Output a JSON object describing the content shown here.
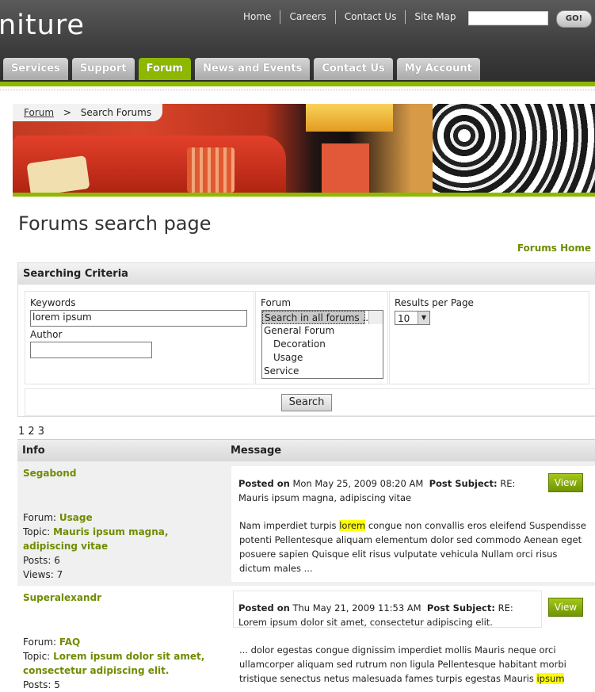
{
  "header": {
    "logo_text": "niture",
    "top_links": [
      "Home",
      "Careers",
      "Contact Us",
      "Site Map"
    ],
    "go_label": "GO!"
  },
  "tabs": [
    "Services",
    "Support",
    "Forum",
    "News and Events",
    "Contact Us",
    "My Account"
  ],
  "active_tab": "Forum",
  "breadcrumb": {
    "link": "Forum",
    "separator": ">",
    "current": "Search Forums"
  },
  "page_title": "Forums search page",
  "forums_home": "Forums Home",
  "criteria": {
    "heading": "Searching Criteria",
    "keywords_label": "Keywords",
    "keywords_value": "lorem ipsum",
    "author_label": "Author",
    "author_value": "",
    "forum_label": "Forum",
    "forum_options": [
      "Search in all forums ...",
      "General Forum",
      "Decoration",
      "Usage",
      "Service"
    ],
    "rpp_label": "Results per Page",
    "rpp_value": "10",
    "search_label": "Search"
  },
  "pagination": "1 2 3",
  "results": {
    "col_info": "Info",
    "col_message": "Message",
    "rows": [
      {
        "user": "Segabond",
        "forum_label": "Forum:",
        "forum": "Usage",
        "topic_label": "Topic:",
        "topic": "Mauris ipsum magna, adipiscing vitae",
        "posts_label": "Posts:",
        "posts": "6",
        "views_label": "Views:",
        "views": "7",
        "posted_on_label": "Posted on",
        "posted_on": "Mon May 25, 2009 08:20 AM",
        "subject_label": "Post Subject:",
        "subject": "RE: Mauris ipsum magna, adipiscing vitae",
        "body_pre": "Nam imperdiet turpis",
        "body_hl": "lorem",
        "body_post": "congue non convallis eros eleifend Suspendisse potenti Pellentesque aliquam elementum dolor sed commodo Aenean eget posuere sapien Quisque elit risus vulputate vehicula Nullam orci risus dictum males ...",
        "view_label": "View"
      },
      {
        "user": "Superalexandr",
        "forum_label": "Forum:",
        "forum": "FAQ",
        "topic_label": "Topic:",
        "topic": "Lorem ipsum dolor sit amet, consectetur adipiscing elit.",
        "posts_label": "Posts:",
        "posts": "5",
        "posted_on_label": "Posted on",
        "posted_on": "Thu May 21, 2009 11:53 AM",
        "subject_label": "Post Subject:",
        "subject": "RE: Lorem ipsum dolor sit amet, consectetur adipiscing elit.",
        "body_pre": "... dolor egestas congue dignissim imperdiet mollis Mauris neque orci ullamcorper aliquam sed rutrum non ligula Pellentesque habitant morbi tristique senectus netus malesuada fames turpis egestas Mauris",
        "body_hl": "ipsum",
        "view_label": "View"
      }
    ]
  },
  "colors": {
    "accent": "#8eb800",
    "link_green": "#6f8c00",
    "highlight": "#ffff00"
  }
}
